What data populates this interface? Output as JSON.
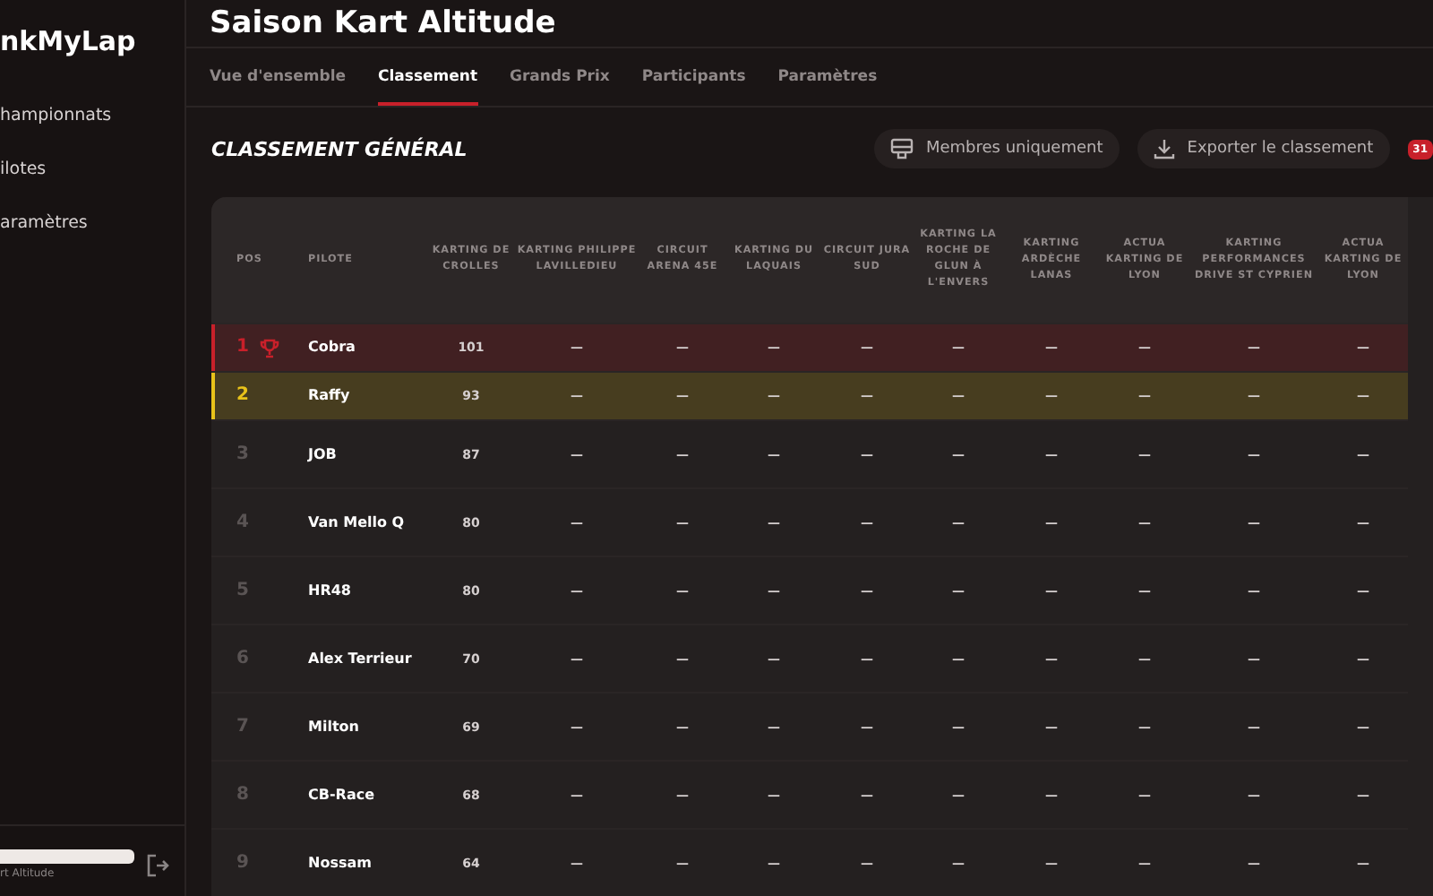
{
  "sidebar": {
    "logo": "nkMyLap",
    "items": [
      {
        "label": "hampionnats"
      },
      {
        "label": "ilotes"
      },
      {
        "label": "aramètres"
      }
    ],
    "footer": {
      "caption": "rt Altitude"
    }
  },
  "header": {
    "title": "Saison Kart Altitude"
  },
  "tabs": [
    {
      "label": "Vue d'ensemble",
      "selected": false
    },
    {
      "label": "Classement",
      "selected": true
    },
    {
      "label": "Grands Prix",
      "selected": false
    },
    {
      "label": "Participants",
      "selected": false
    },
    {
      "label": "Paramètres",
      "selected": false
    }
  ],
  "section": {
    "title": "CLASSEMENT GÉNÉRAL",
    "buttons": [
      {
        "label": "Membres uniquement",
        "kind": "members"
      },
      {
        "label": "Exporter le classement",
        "kind": "export"
      }
    ],
    "badge": "31"
  },
  "table": {
    "columns": [
      "POS",
      "PILOTE",
      "KARTING DE CROLLES",
      "KARTING PHILIPPE LAVILLEDIEU",
      "CIRCUIT ARENA 45E",
      "KARTING DU LAQUAIS",
      "CIRCUIT JURA SUD",
      "KARTING LA ROCHE DE GLUN À L'ENVERS",
      "KARTING ARDÈCHE LANAS",
      "ACTUA KARTING DE LYON",
      "KARTING PERFORMANCES DRIVE ST CYPRIEN",
      "ACTUA KARTING DE LYON"
    ],
    "rows": [
      {
        "cells": [
          "1",
          "Cobra",
          "101",
          "—",
          "—",
          "—",
          "—",
          "—",
          "—",
          "—",
          "—",
          "—"
        ],
        "color": "#c8202a",
        "trophy": true
      },
      {
        "cells": [
          "2",
          "Raffy",
          "93",
          "—",
          "—",
          "—",
          "—",
          "—",
          "—",
          "—",
          "—",
          "—"
        ],
        "color": "#e8c21a",
        "trophy": false
      },
      {
        "cells": [
          "3",
          "JOB",
          "87",
          "—",
          "—",
          "—",
          "—",
          "—",
          "—",
          "—",
          "—",
          "—"
        ],
        "trophy": false
      },
      {
        "cells": [
          "4",
          "Van Mello Q",
          "80",
          "—",
          "—",
          "—",
          "—",
          "—",
          "—",
          "—",
          "—",
          "—"
        ],
        "trophy": false
      },
      {
        "cells": [
          "5",
          "HR48",
          "80",
          "—",
          "—",
          "—",
          "—",
          "—",
          "—",
          "—",
          "—",
          "—"
        ],
        "trophy": false
      },
      {
        "cells": [
          "6",
          "Alex Terrieur",
          "70",
          "—",
          "—",
          "—",
          "—",
          "—",
          "—",
          "—",
          "—",
          "—"
        ],
        "trophy": false
      },
      {
        "cells": [
          "7",
          "Milton",
          "69",
          "—",
          "—",
          "—",
          "—",
          "—",
          "—",
          "—",
          "—",
          "—"
        ],
        "trophy": false
      },
      {
        "cells": [
          "8",
          "CB-Race",
          "68",
          "—",
          "—",
          "—",
          "—",
          "—",
          "—",
          "—",
          "—",
          "—"
        ],
        "trophy": false
      },
      {
        "cells": [
          "9",
          "Nossam",
          "64",
          "—",
          "—",
          "—",
          "—",
          "—",
          "—",
          "—",
          "—",
          "—"
        ],
        "trophy": false
      }
    ]
  }
}
